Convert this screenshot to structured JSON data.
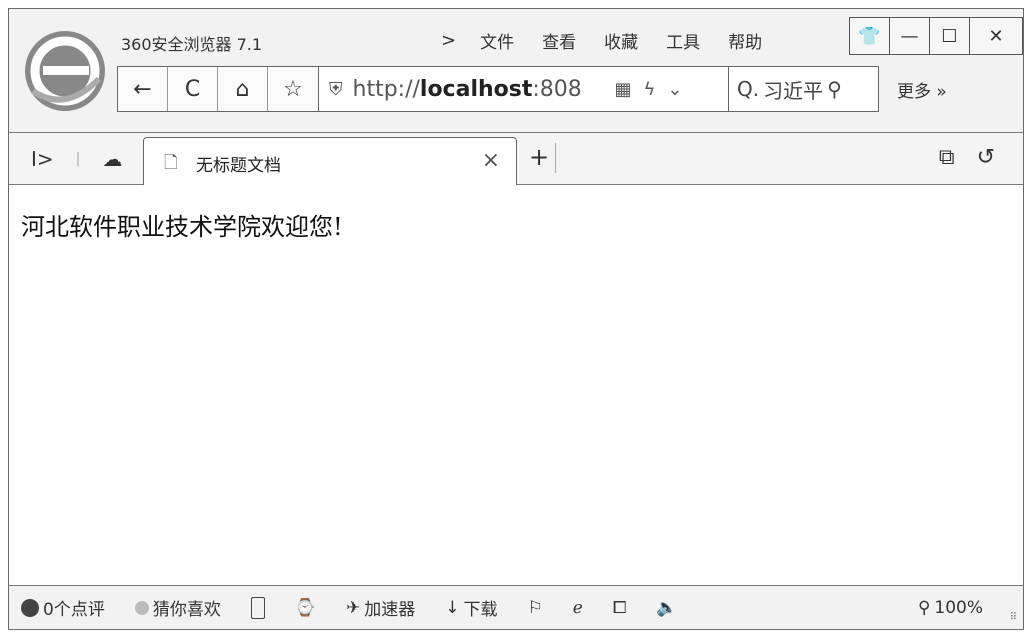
{
  "window": {
    "app_title": "360安全浏览器 7.1"
  },
  "menu": {
    "arrow": ">",
    "items": [
      "文件",
      "查看",
      "收藏",
      "工具",
      "帮助"
    ]
  },
  "window_controls": {
    "skin": "👕",
    "minimize": "—",
    "maximize": "☐",
    "close": "✕"
  },
  "toolbar": {
    "back": "←",
    "refresh": "C",
    "home": "⌂",
    "favorite": "☆",
    "url_prefix": "http://",
    "url_host": "localhost",
    "url_port": ":808",
    "qr": "▦",
    "lightning": "ϟ",
    "dropdown": "⌄",
    "search_prefix": "Q.",
    "search_text": "习近平",
    "search_icon": "🔍",
    "more": "更多 »"
  },
  "tabs": {
    "sidebar_toggle": "I>",
    "cloud": "☁",
    "active_tab_title": "无标题文档",
    "close": "×",
    "new_tab": "+",
    "restore": "⧉",
    "undo": "↺"
  },
  "content": {
    "welcome_text": "河北软件职业技术学院欢迎您!"
  },
  "statusbar": {
    "reviews": "0个点评",
    "guess": "猜你喜欢",
    "accelerator": "加速器",
    "download": "下载",
    "zoom": "100%"
  }
}
